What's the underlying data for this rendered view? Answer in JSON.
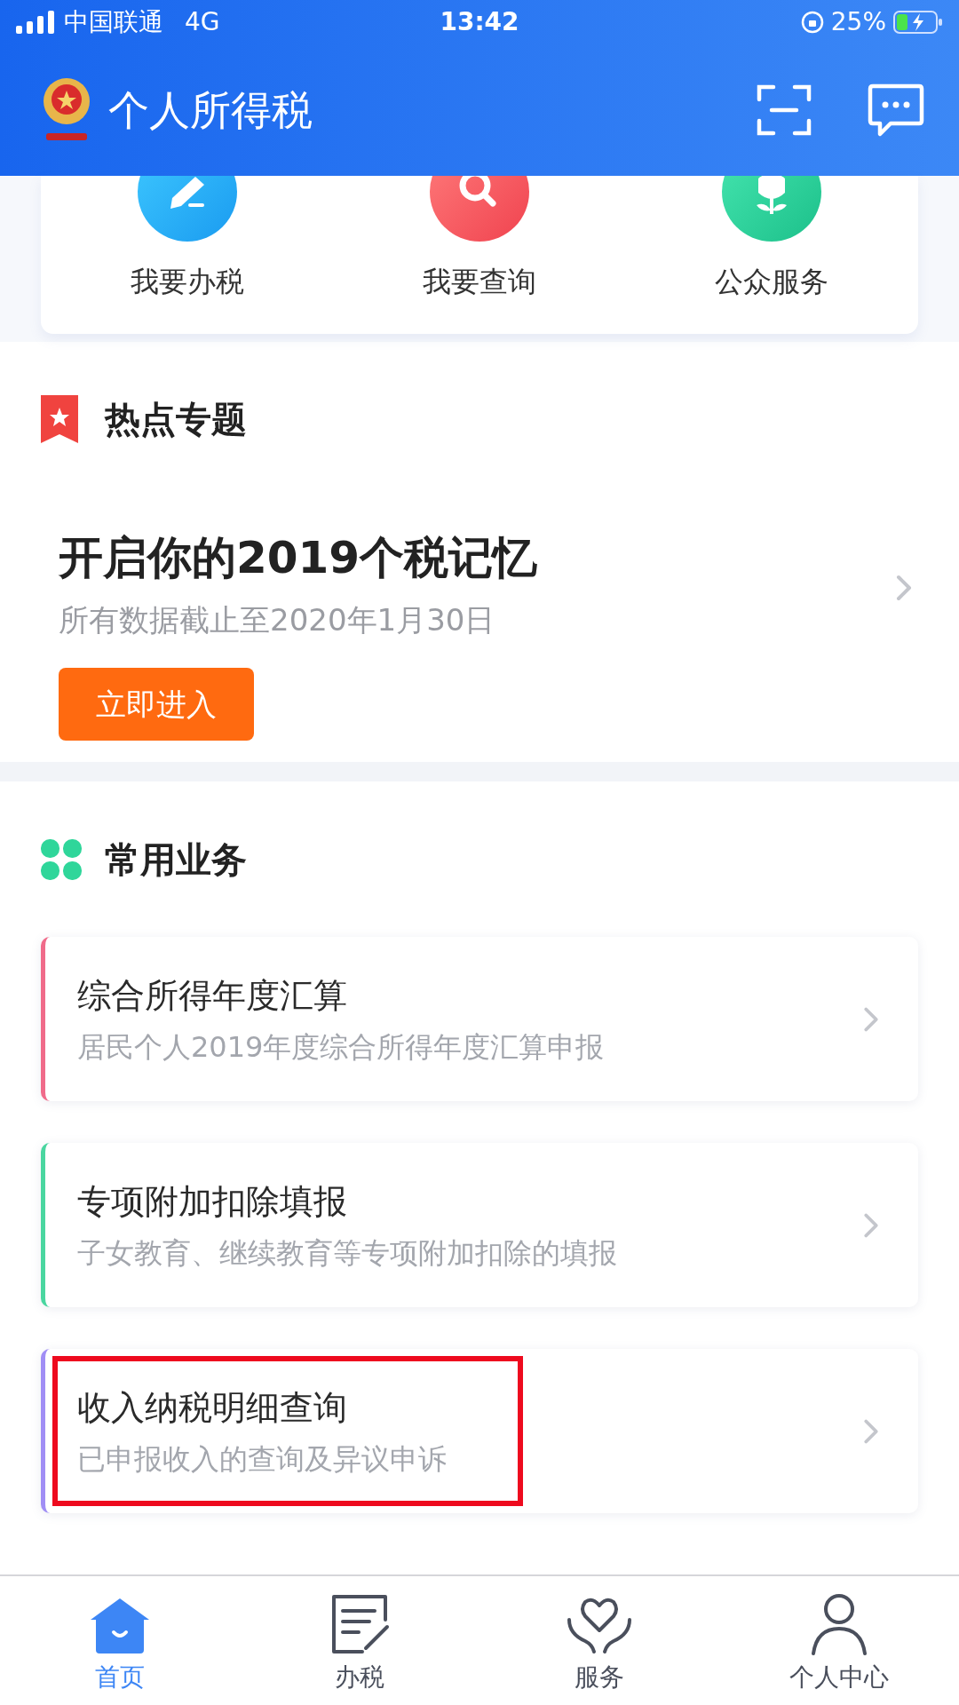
{
  "status_bar": {
    "carrier": "中国联通",
    "network": "4G",
    "time": "13:42",
    "battery": "25%"
  },
  "header": {
    "title": "个人所得税"
  },
  "quick_actions": [
    {
      "label": "我要办税",
      "kind": "pencil"
    },
    {
      "label": "我要查询",
      "kind": "search"
    },
    {
      "label": "公众服务",
      "kind": "plant"
    }
  ],
  "hot_topics": {
    "title": "热点专题",
    "banner": {
      "title": "开启你的2019个税记忆",
      "subtitle": "所有数据截止至2020年1月30日",
      "button": "立即进入"
    }
  },
  "common_services": {
    "title": "常用业务",
    "items": [
      {
        "title": "综合所得年度汇算",
        "subtitle": "居民个人2019年度综合所得年度汇算申报",
        "color": "#f06b8a",
        "highlighted": false
      },
      {
        "title": "专项附加扣除填报",
        "subtitle": "子女教育、继续教育等专项附加扣除的填报",
        "color": "#4ad6a0",
        "highlighted": false
      },
      {
        "title": "收入纳税明细查询",
        "subtitle": "已申报收入的查询及异议申诉",
        "color": "#a08ef5",
        "highlighted": true
      }
    ]
  },
  "tab_bar": [
    {
      "label": "首页",
      "kind": "home",
      "selected": true
    },
    {
      "label": "办税",
      "kind": "tax",
      "selected": false
    },
    {
      "label": "服务",
      "kind": "service",
      "selected": false
    },
    {
      "label": "个人中心",
      "kind": "user",
      "selected": false
    }
  ]
}
